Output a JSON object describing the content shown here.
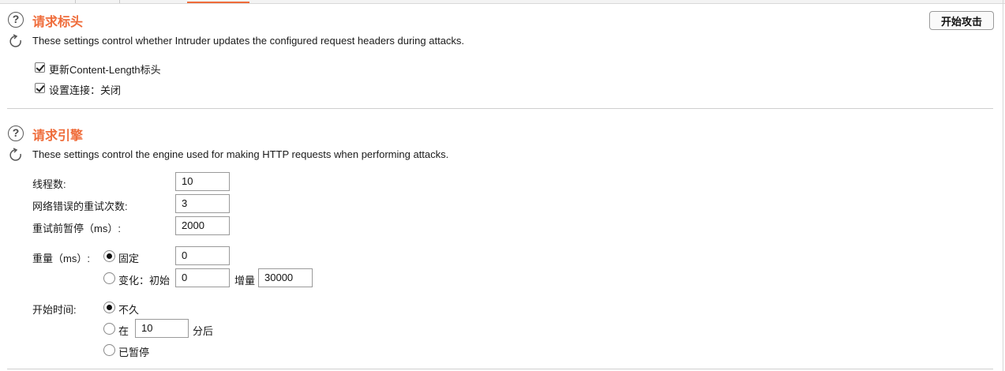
{
  "header": {
    "start_attack_label": "开始攻击"
  },
  "request_headers": {
    "title": "请求标头",
    "description": "These settings control whether Intruder updates the configured request headers during attacks.",
    "update_content_length_label": "更新Content-Length标头",
    "set_connection_close_label": "设置连接：关闭"
  },
  "request_engine": {
    "title": "请求引擎",
    "description": "These settings control the engine used for making HTTP requests when performing attacks.",
    "threads_label": "线程数:",
    "threads_value": "10",
    "retries_label": "网络错误的重试次数:",
    "retries_value": "3",
    "pause_label": "重试前暂停（ms）:",
    "pause_value": "2000",
    "throttle_label": "重量（ms）:",
    "throttle_fixed_label": "固定",
    "throttle_fixed_value": "0",
    "throttle_variable_label": "变化：初始",
    "throttle_variable_initial": "0",
    "throttle_increment_label": "增量",
    "throttle_increment_value": "30000",
    "start_time_label": "开始时间:",
    "start_immediately_label": "不久",
    "start_in_label": "在",
    "start_in_value": "10",
    "start_in_unit": "分后",
    "start_paused_label": "已暂停"
  },
  "icons": {
    "help": "?",
    "refresh": "refresh-icon"
  },
  "colors": {
    "accent": "#ef6c3a"
  }
}
